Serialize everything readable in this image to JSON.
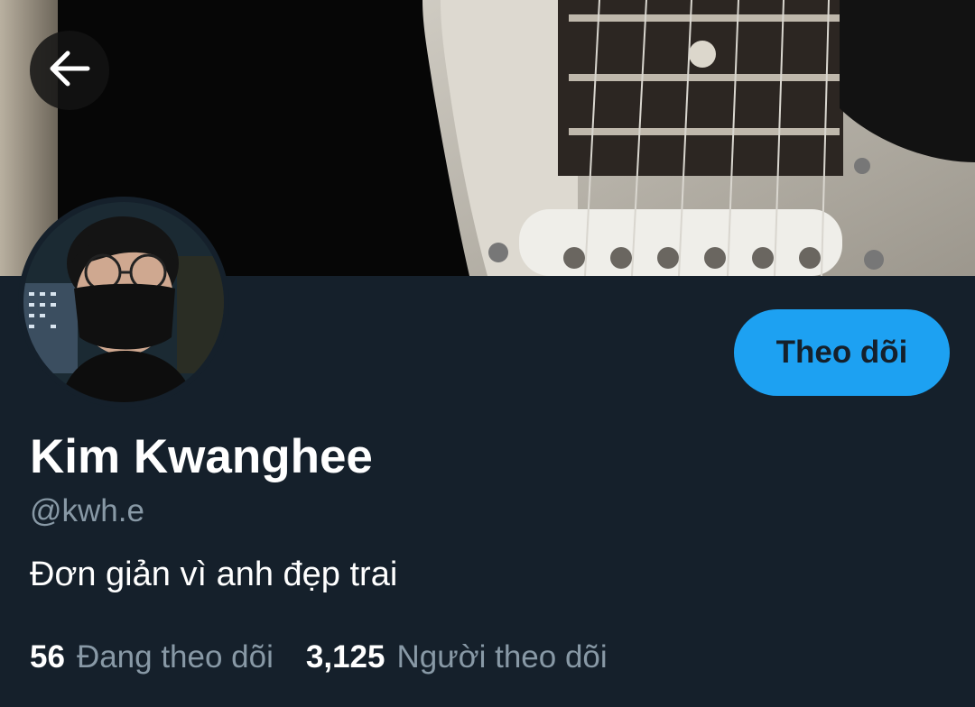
{
  "header": {
    "back_icon": "arrow-left-icon",
    "banner_image": "electric-guitar-photo"
  },
  "profile": {
    "avatar_image": "man-with-glasses-and-black-mask",
    "name": "Kim Kwanghee",
    "handle": "@kwh.e",
    "bio": "Đơn giản vì anh đẹp trai",
    "follow_label": "Theo dõi"
  },
  "stats": {
    "following_count": "56",
    "following_label": "Đang theo dõi",
    "followers_count": "3,125",
    "followers_label": "Người theo dõi"
  },
  "colors": {
    "background": "#15202b",
    "accent": "#1da1f2",
    "secondary_text": "#8899a6",
    "primary_text": "#ffffff"
  }
}
